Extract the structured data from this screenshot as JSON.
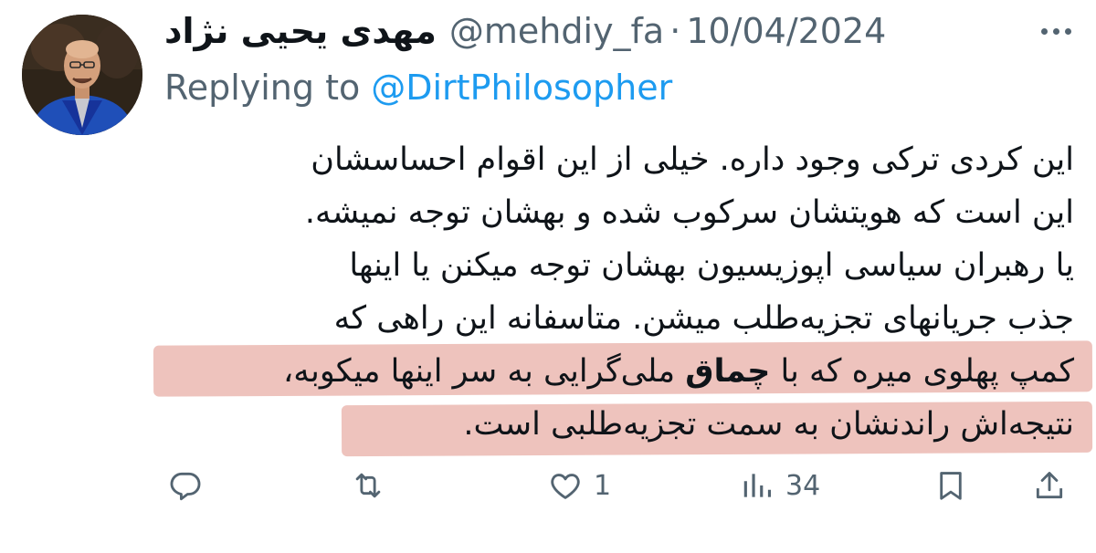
{
  "tweet": {
    "author": {
      "display_name": "مهدی یحیی نژاد",
      "handle": "@mehdiy_fa",
      "separator": "·",
      "avatar_icon": "profile-photo"
    },
    "date": "10/04/2024",
    "replying_to": {
      "label": "Replying to",
      "target": "@DirtPhilosopher"
    },
    "text_lines": [
      "این کردی ترکی وجود داره. خیلی از این اقوام احساسشان",
      "این است که هویتشان سرکوب شده و بهشان توجه نمیشه.",
      "یا رهبران سیاسی اپوزیسیون بهشان توجه میکنن یا اینها",
      "جذب جریانهای تجزیه‌طلب میشن. متاسفانه این راهی که"
    ],
    "highlighted": {
      "line5_before": "کمپ پهلوی میره که با ",
      "line5_bold": "چماق",
      "line5_after": " ملی‌گرایی به سر اینها میکوبه،",
      "line6": "نتیجه‌اش راندنشان به سمت تجزیه‌طلبی است."
    },
    "highlight_color": "#e9b2ab",
    "link_color": "#1d9bf0",
    "muted_color": "#536471",
    "actions": {
      "reply": {
        "icon": "reply-icon",
        "count": ""
      },
      "retweet": {
        "icon": "retweet-icon",
        "count": ""
      },
      "like": {
        "icon": "heart-icon",
        "count": "1"
      },
      "views": {
        "icon": "analytics-icon",
        "count": "34"
      },
      "bookmark": {
        "icon": "bookmark-icon"
      },
      "share": {
        "icon": "share-icon"
      }
    }
  }
}
